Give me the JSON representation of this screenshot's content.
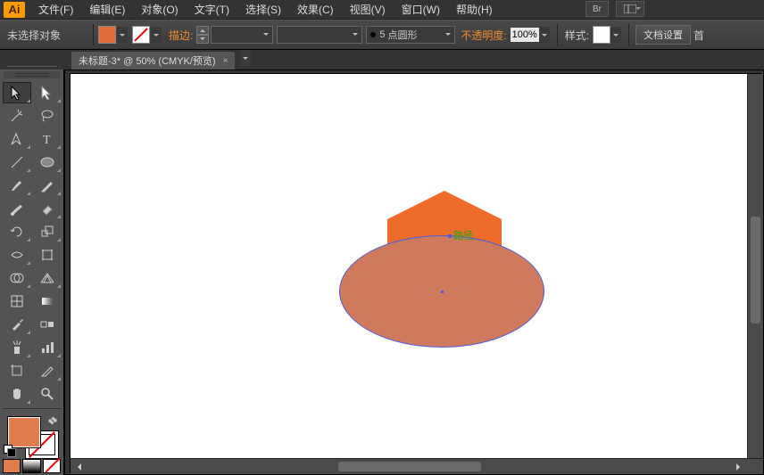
{
  "app": {
    "logo_text": "Ai"
  },
  "menu": {
    "file": "文件(F)",
    "edit": "编辑(E)",
    "object": "对象(O)",
    "type": "文字(T)",
    "select": "选择(S)",
    "effect": "效果(C)",
    "view": "视图(V)",
    "window": "窗口(W)",
    "help": "帮助(H)",
    "br": "Br"
  },
  "ctrl": {
    "no_selection": "未选择对象",
    "stroke_label": "描边:",
    "stroke_weight": "5",
    "stroke_profile": "点圆形",
    "opacity_label": "不透明度:",
    "opacity_value": "100%",
    "style_label": "样式:",
    "doc_setup": "文档设置",
    "extra": "首"
  },
  "tab": {
    "title": "未标题-3* @ 50% (CMYK/预览)",
    "close": "×"
  },
  "canvas": {
    "annotation": "路径"
  }
}
